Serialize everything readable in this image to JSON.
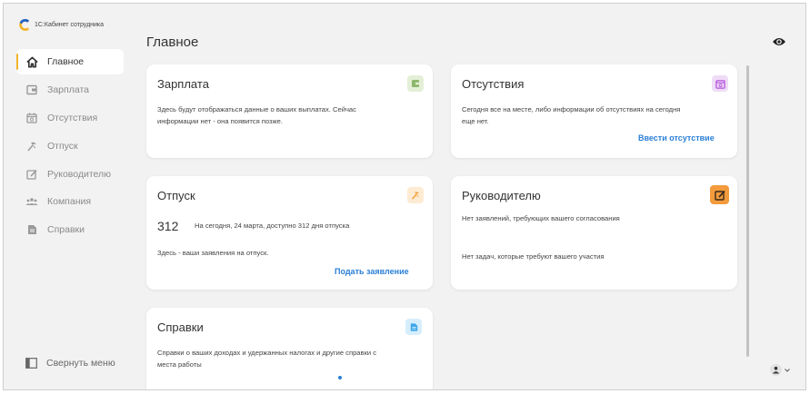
{
  "app": {
    "name": "1С:Кабинет сотрудника"
  },
  "page": {
    "title": "Главное"
  },
  "sidebar": {
    "items": [
      {
        "label": "Главное",
        "icon": "home-icon",
        "active": true
      },
      {
        "label": "Зарплата",
        "icon": "wallet-icon",
        "active": false
      },
      {
        "label": "Отсутствия",
        "icon": "calendar-icon",
        "active": false
      },
      {
        "label": "Отпуск",
        "icon": "palm-icon",
        "active": false
      },
      {
        "label": "Руководителю",
        "icon": "manager-icon",
        "active": false
      },
      {
        "label": "Компания",
        "icon": "people-icon",
        "active": false
      },
      {
        "label": "Справки",
        "icon": "document-icon",
        "active": false
      }
    ],
    "collapse_label": "Свернуть меню"
  },
  "cards": {
    "salary": {
      "title": "Зарплата",
      "icon": "wallet-icon",
      "text_line1": "Здесь будут отображаться данные о ваших выплатах. Сейчас",
      "text_line2": "информации нет - она появится позже."
    },
    "absences": {
      "title": "Отсутствия",
      "icon": "calendar-icon",
      "text_line1": "Сегодня все на месте, либо информации об отсутствиях на сегодня",
      "text_line2": "еще нет.",
      "link": "Ввести отсутствие"
    },
    "vacation": {
      "title": "Отпуск",
      "icon": "palm-icon",
      "days": "312",
      "days_text": "На сегодня, 24 марта, доступно 312 дня отпуска",
      "text": "Здесь - ваши заявления на отпуск.",
      "link": "Подать заявление"
    },
    "manager": {
      "title": "Руководителю",
      "icon": "manager-icon",
      "text1": "Нет заявлений, требующих вашего согласования",
      "text2": "Нет задач, которые требуют вашего участия"
    },
    "certificates": {
      "title": "Справки",
      "icon": "document-icon",
      "text_line1": "Справки о ваших доходах и удержанных налогах и другие справки с",
      "text_line2": "места работы"
    }
  },
  "colors": {
    "accent": "#f2b42c",
    "link": "#2a7fd6",
    "badge_salary": "#e3efd6",
    "badge_absences": "#efdcf7",
    "badge_vacation": "#fdebd3",
    "badge_manager": "#f39b3c",
    "badge_certificates": "#d6eefc"
  }
}
